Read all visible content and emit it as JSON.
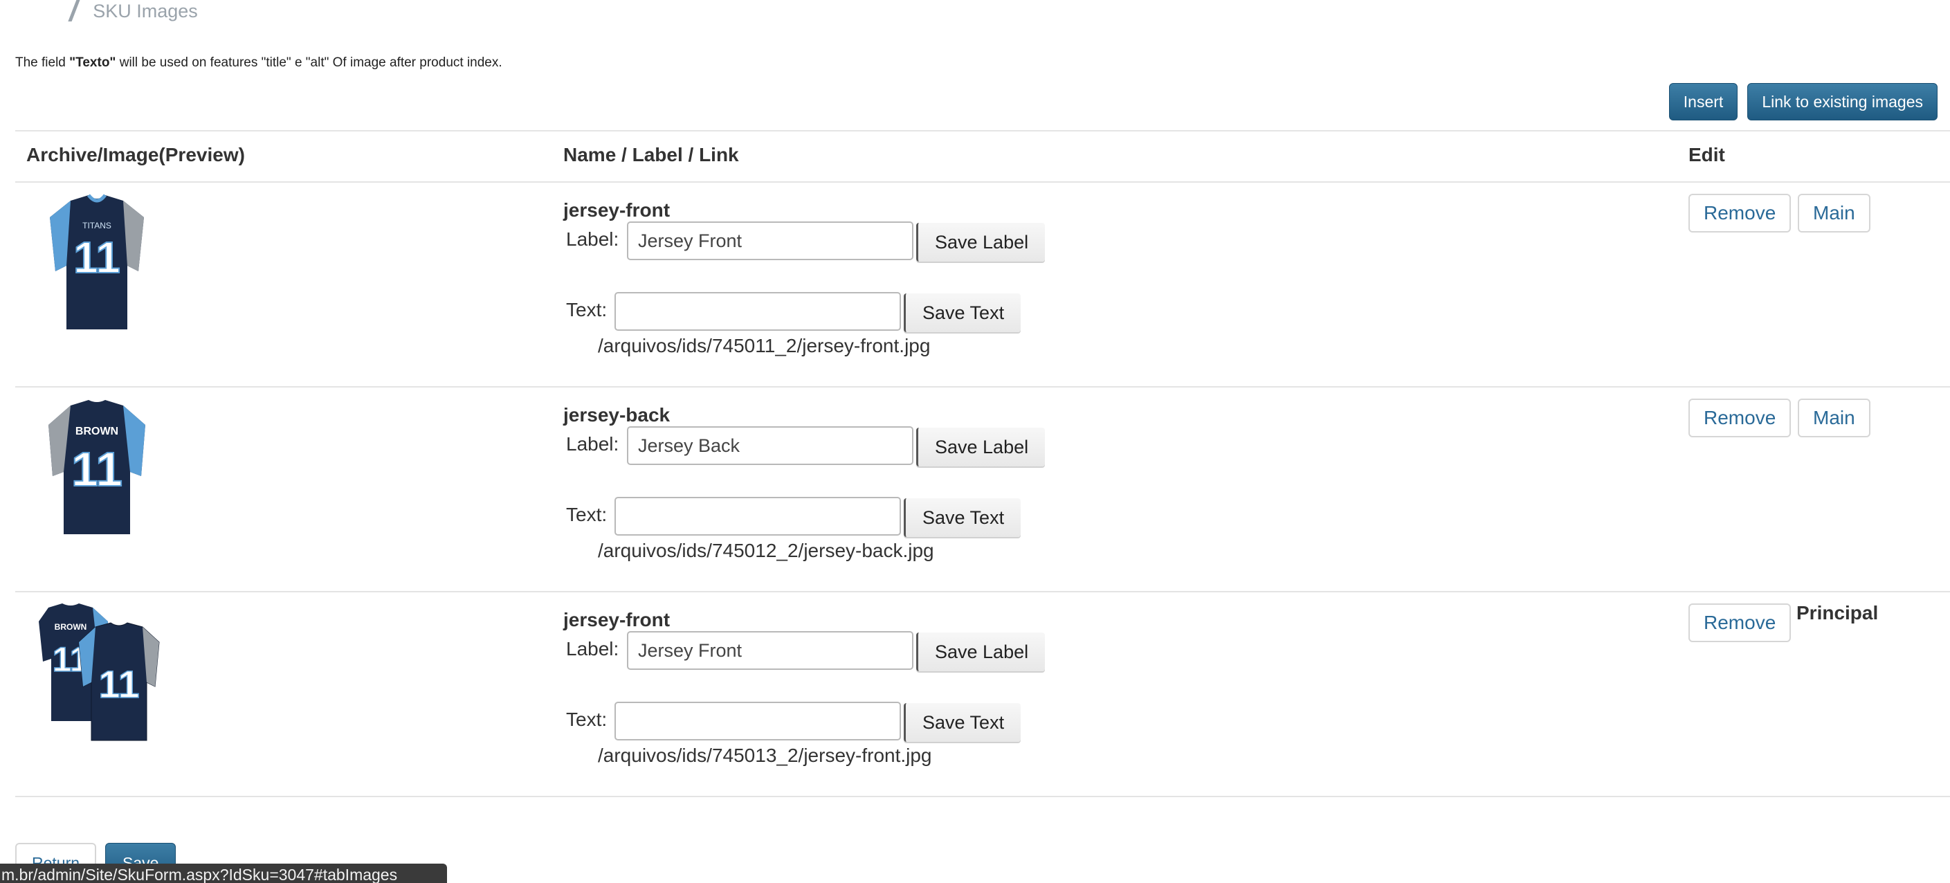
{
  "breadcrumb": {
    "separator": "/",
    "current": "SKU Images"
  },
  "note": {
    "prefix": "The field ",
    "field": "\"Texto\"",
    "suffix": " will be used on features \"title\" e \"alt\" Of image after product index."
  },
  "toolbar": {
    "insert_label": "Insert",
    "link_label": "Link to existing images"
  },
  "table": {
    "headers": {
      "preview": "Archive/Image(Preview)",
      "name": "Name / Label / Link",
      "edit": "Edit"
    },
    "rows": [
      {
        "thumb_icon": "jersey-front-thumbnail",
        "filename": "jersey-front",
        "label_caption": "Label:",
        "label_value": "Jersey Front",
        "save_label": "Save Label",
        "text_caption": "Text:",
        "text_value": "",
        "save_text": "Save Text",
        "path": "/arquivos/ids/745011_2/jersey-front.jpg",
        "remove_label": "Remove",
        "main_label": "Main"
      },
      {
        "thumb_icon": "jersey-back-thumbnail",
        "filename": "jersey-back",
        "label_caption": "Label:",
        "label_value": "Jersey Back",
        "save_label": "Save Label",
        "text_caption": "Text:",
        "text_value": "",
        "save_text": "Save Text",
        "path": "/arquivos/ids/745012_2/jersey-back.jpg",
        "remove_label": "Remove",
        "main_label": "Main"
      },
      {
        "thumb_icon": "jersey-pair-thumbnail",
        "filename": "jersey-front",
        "label_caption": "Label:",
        "label_value": "Jersey Front",
        "save_label": "Save Label",
        "text_caption": "Text:",
        "text_value": "",
        "save_text": "Save Text",
        "path": "/arquivos/ids/745013_2/jersey-front.jpg",
        "remove_label": "Remove",
        "principal_label": "Principal"
      }
    ]
  },
  "footer": {
    "return_label": "Return",
    "save_label": "Save"
  },
  "status_url": "m.br/admin/Site/SkuForm.aspx?IdSku=3047#tabImages",
  "colors": {
    "accent": "#1f5b82",
    "link": "#2a6a98",
    "jersey_navy": "#1a2a48",
    "jersey_blue": "#5b9fd6",
    "jersey_grey": "#9aa0a6"
  }
}
